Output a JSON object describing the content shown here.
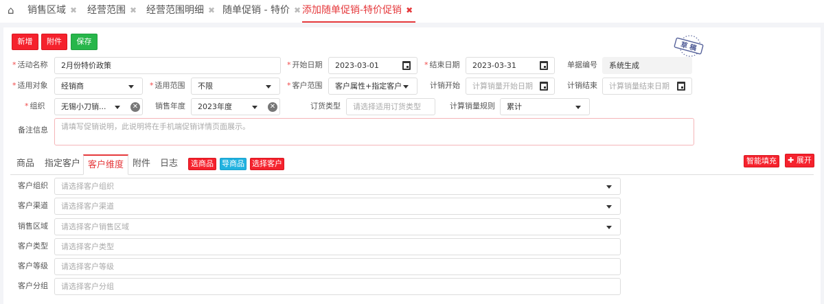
{
  "tabs": [
    {
      "label": "销售区域"
    },
    {
      "label": "经营范围"
    },
    {
      "label": "经营范围明细"
    },
    {
      "label": "随单促销 - 特价"
    },
    {
      "label": "添加随单促销-特价促销",
      "active": true
    }
  ],
  "toolbar": {
    "add": "新增",
    "attach": "附件",
    "save": "保存"
  },
  "stamp": "草稿",
  "form": {
    "name": {
      "label": "活动名称",
      "value": "2月份特价政策"
    },
    "start": {
      "label": "开始日期",
      "value": "2023-03-01"
    },
    "end": {
      "label": "结束日期",
      "value": "2023-03-31"
    },
    "docno": {
      "label": "单据编号",
      "value": "系统生成"
    },
    "target": {
      "label": "适用对象",
      "value": "经销商"
    },
    "scope": {
      "label": "适用范围",
      "value": "不限"
    },
    "custscope": {
      "label": "客户范围",
      "value": "客户属性+指定客户"
    },
    "calcstart": {
      "label": "计销开始",
      "placeholder": "计算销量开始日期"
    },
    "calcend": {
      "label": "计销结束",
      "placeholder": "计算销量结束日期"
    },
    "org": {
      "label": "组织",
      "value": "无锡小刀销..."
    },
    "year": {
      "label": "销售年度",
      "value": "2023年度"
    },
    "ordertype": {
      "label": "订货类型",
      "placeholder": "请选择适用订货类型"
    },
    "rule": {
      "label": "计算销量规则",
      "value": "累计"
    },
    "remark": {
      "label": "备注信息",
      "placeholder": "请填写促销说明，此说明将在手机端促销详情页面展示。"
    }
  },
  "subtabs": [
    "商品",
    "指定客户",
    "客户维度",
    "附件",
    "日志"
  ],
  "subbuttons": {
    "pick": "选商品",
    "import": "导商品",
    "pickcust": "选择客户",
    "autofill": "智能填充",
    "expand": "展开"
  },
  "dims": [
    {
      "label": "客户组织",
      "placeholder": "请选择客户组织"
    },
    {
      "label": "客户渠道",
      "placeholder": "请选择客户渠道"
    },
    {
      "label": "销售区域",
      "placeholder": "请选择客户销售区域"
    },
    {
      "label": "客户类型",
      "placeholder": "请选择客户类型"
    },
    {
      "label": "客户等级",
      "placeholder": "请选择客户等级"
    },
    {
      "label": "客户分组",
      "placeholder": "请选择客户分组"
    }
  ],
  "colors": {
    "accent": "#e5383b",
    "green": "#27b64a",
    "blue": "#21b2e0"
  }
}
